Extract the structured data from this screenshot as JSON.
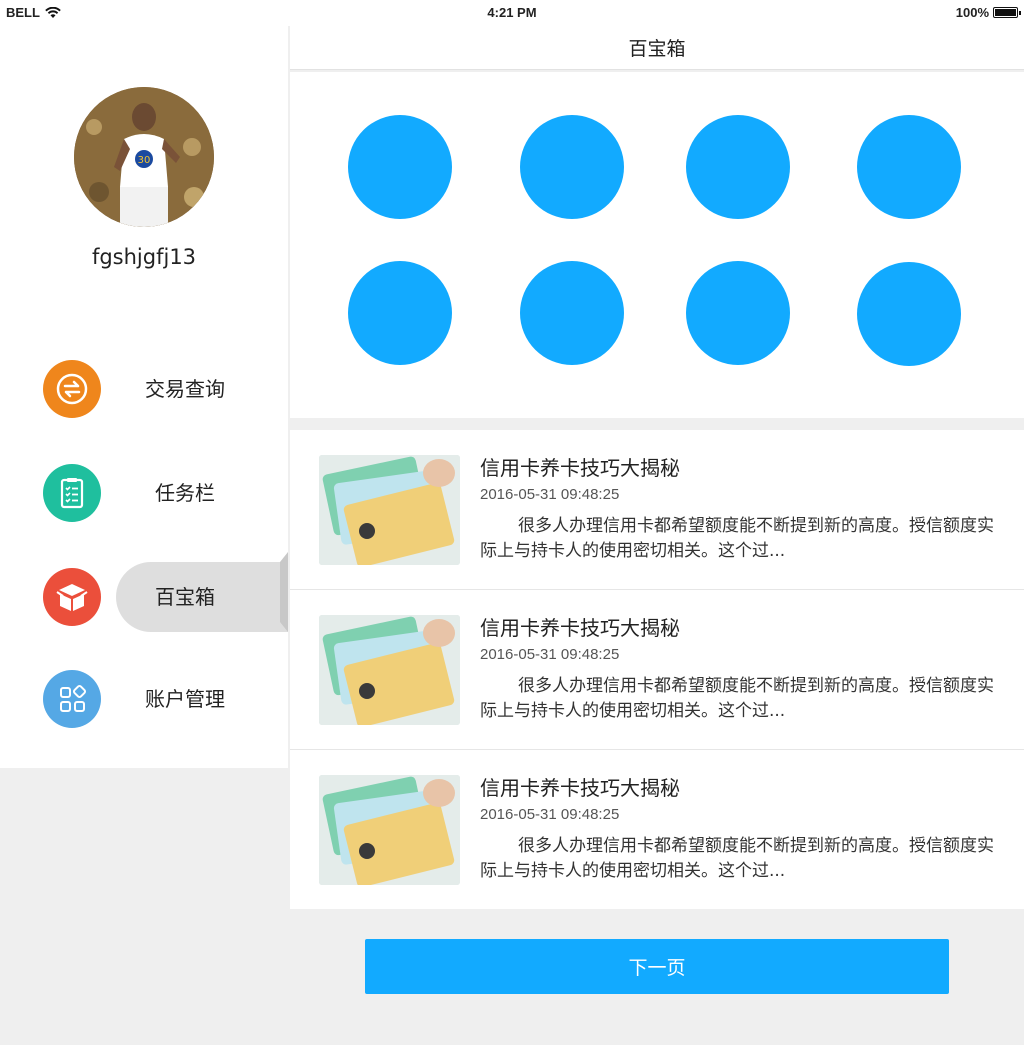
{
  "status_bar": {
    "carrier": "BELL",
    "time": "4:21 PM",
    "battery": "100%"
  },
  "sidebar": {
    "username": "fgshjgfj13",
    "items": [
      {
        "label": "交易查询",
        "icon": "exchange-icon",
        "color": "#ef861c",
        "active": false
      },
      {
        "label": "任务栏",
        "icon": "clipboard-icon",
        "color": "#1fbf9e",
        "active": false
      },
      {
        "label": "百宝箱",
        "icon": "box-icon",
        "color": "#eb4f3b",
        "active": true
      },
      {
        "label": "账户管理",
        "icon": "grid-apps-icon",
        "color": "#55a8e5",
        "active": false
      }
    ]
  },
  "header": {
    "title": "百宝箱"
  },
  "grid": {
    "count": 8,
    "color": "#12aaff"
  },
  "news": [
    {
      "title": "信用卡养卡技巧大揭秘",
      "date": "2016-05-31 09:48:25",
      "summary": "很多人办理信用卡都希望额度能不断提到新的高度。授信额度实际上与持卡人的使用密切相关。这个过..."
    },
    {
      "title": "信用卡养卡技巧大揭秘",
      "date": "2016-05-31 09:48:25",
      "summary": "很多人办理信用卡都希望额度能不断提到新的高度。授信额度实际上与持卡人的使用密切相关。这个过..."
    },
    {
      "title": "信用卡养卡技巧大揭秘",
      "date": "2016-05-31 09:48:25",
      "summary": "很多人办理信用卡都希望额度能不断提到新的高度。授信额度实际上与持卡人的使用密切相关。这个过..."
    }
  ],
  "pagination": {
    "next_label": "下一页"
  }
}
